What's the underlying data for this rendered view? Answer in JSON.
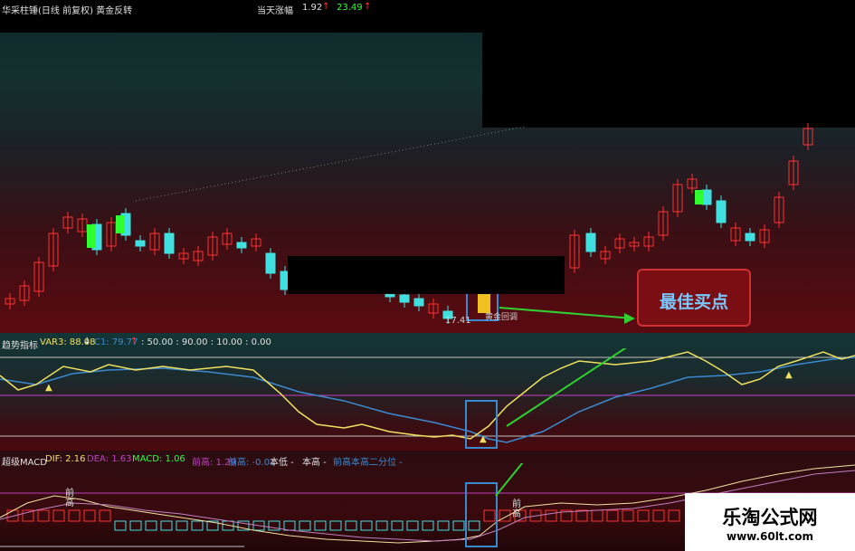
{
  "main_chart": {
    "title": "华采柱锤(日线 前复权) 黄金反转",
    "today_change_label": "当天涨幅",
    "today_change_value": "1.92",
    "close_value": "23.49",
    "low_price_label": "17.41",
    "signal_label": "黄金回调"
  },
  "indicator1": {
    "name": "趋势指标",
    "var3": "VAR3: 88.08",
    "c1": "C1: 79.77",
    "levels": ": 50.00 : 90.00 : 10.00 : 0.00"
  },
  "indicator2": {
    "name": "超级MACD",
    "dif": "DIF: 2.16",
    "dea": "DEA: 1.63",
    "macd": "MACD: 1.06",
    "prev_high": "前高: 1.29",
    "extra": "前高: -0.01",
    "ben_di": "本低 -",
    "ben_gao": "本高 -",
    "prev_high_split": "前高本高二分位 -",
    "marker_prev_high_1": "前高",
    "marker_prev_high_2": "前高"
  },
  "callout": {
    "text": "最佳买点"
  },
  "watermark": {
    "title": "乐淘公式网",
    "url": "www.60lt.com"
  },
  "colors": {
    "up": "#ff3030",
    "down": "#40e0e0",
    "buy": "#30ff30",
    "yellow": "#f0e060",
    "blue": "#3a8ad0"
  }
}
